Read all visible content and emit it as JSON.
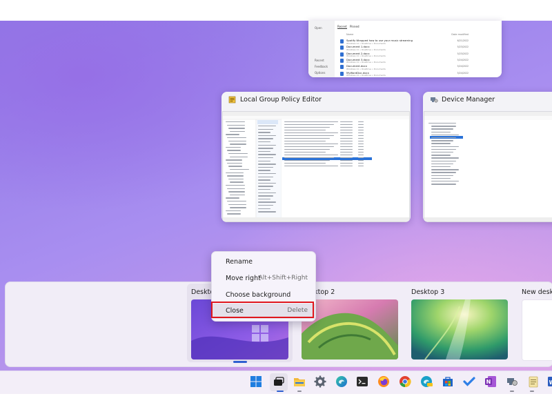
{
  "windows": {
    "file_explorer": {
      "sidebar": [
        "Open",
        "Recent",
        "Feedback",
        "Options"
      ],
      "tabs": [
        "Recent",
        "Pinned"
      ],
      "columns": [
        "Name",
        "Date modified"
      ],
      "files": [
        {
          "name": "Spotify Wrapped how to use your music streaming",
          "sub": "Windows 11 » OneDrive » Documents",
          "date": "6/21/2022"
        },
        {
          "name": "Document 1.docx",
          "sub": "Windows 11 » OneDrive » Documents",
          "date": "5/23/2022"
        },
        {
          "name": "Document 2.docx",
          "sub": "Windows 11 » OneDrive » Documents",
          "date": "5/23/2022"
        },
        {
          "name": "Document 3.docx",
          "sub": "Windows 11 » OneDrive » Documents",
          "date": "5/24/2022"
        },
        {
          "name": "Document.docx",
          "sub": "Windows 11 » OneDrive » Documents",
          "date": "5/24/2022"
        },
        {
          "name": "MyWordDoc.docx",
          "sub": "Windows 11 » OneDrive » Documents",
          "date": "5/24/2022"
        }
      ]
    },
    "gpedit": {
      "title": "Local Group Policy Editor"
    },
    "device_manager": {
      "title": "Device Manager"
    }
  },
  "context_menu": {
    "rename": "Rename",
    "move_right": "Move right",
    "move_right_shortcut": "Alt+Shift+Right",
    "choose_background": "Choose background",
    "close": "Close",
    "close_shortcut": "Delete"
  },
  "desktops": {
    "d1": "Desktop 1",
    "d2": "Desktop 2",
    "d3": "Desktop 3",
    "new": "New desktop"
  },
  "taskbar": {
    "icons": [
      "windows-start",
      "task-view",
      "file-explorer",
      "settings",
      "edge",
      "terminal",
      "firefox",
      "chrome",
      "edge-canary",
      "store",
      "todo",
      "onenote",
      "device-manager",
      "notepad",
      "word"
    ]
  },
  "colors": {
    "accent": "#2e5fd0",
    "highlight_border": "#e0161c"
  }
}
